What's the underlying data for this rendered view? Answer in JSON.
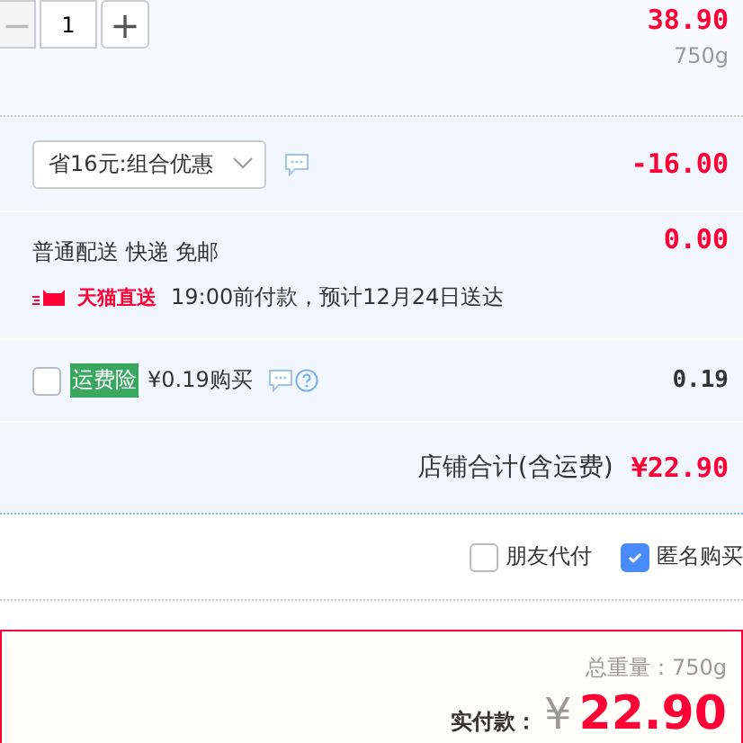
{
  "item": {
    "minus": "−",
    "quantity": "1",
    "plus": "+",
    "price": "38.90",
    "weight": "750g"
  },
  "discount": {
    "select": "省16元:组合优惠",
    "amount": "-16.00"
  },
  "delivery": {
    "method": "普通配送 快递 免邮",
    "badge": "天猫直送",
    "note": "19:00前付款，预计12月24日送达",
    "amount": "0.00"
  },
  "insurance": {
    "checked": false,
    "badge": "运费险",
    "label": "¥0.19购买",
    "amount": "0.19"
  },
  "shop_total": {
    "label": "店铺合计(含运费)",
    "amount": "¥22.90"
  },
  "options": [
    {
      "label": "朋友代付",
      "checked": false
    },
    {
      "label": "匿名购买",
      "checked": true
    }
  ],
  "summary": {
    "weight": "总重量：750g",
    "pay_label": "实付款：",
    "currency": "¥",
    "amount": "22.90"
  }
}
